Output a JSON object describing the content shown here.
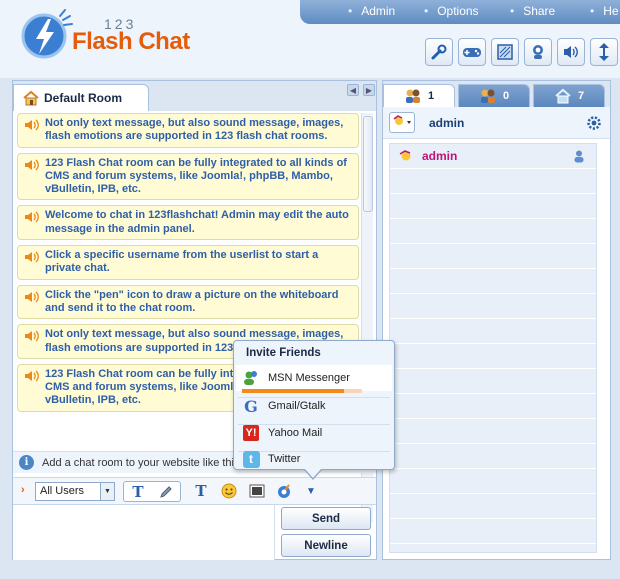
{
  "app": {
    "logo_number": "123",
    "logo_name": "Flash Chat"
  },
  "topnav": {
    "items": [
      "Admin",
      "Options",
      "Share",
      "He"
    ]
  },
  "toolbar_icons": [
    "wrench-icon",
    "gamepad-icon",
    "window-icon",
    "avatar-icon",
    "speaker-icon",
    "resize-icon"
  ],
  "room": {
    "tab_label": "Default Room"
  },
  "messages": [
    "Not only text message, but also sound message, images, flash emotions are supported in 123 flash chat rooms.",
    "123 Flash Chat room can be fully integrated to all kinds of CMS and forum systems, like Joomla!, phpBB, Mambo, vBulletin, IPB, etc.",
    "Welcome to chat in 123flashchat! Admin may edit the auto message in the admin panel.",
    "Click a specific username from the userlist to start a private chat.",
    "Click the \"pen\" icon to draw a picture on the whiteboard and send it to the chat room.",
    "Not only text message, but also sound message, images, flash emotions are supported in 123 flash chat rooms.",
    "123 Flash Chat room can be fully integrated to all kinds of CMS and forum systems, like Joomla!, phpBB, Mambo, vBulletin, IPB, etc."
  ],
  "notice": {
    "text": "Add a chat room to your website like this"
  },
  "input": {
    "recipient": "All Users",
    "send_label": "Send",
    "newline_label": "Newline"
  },
  "user_tabs": [
    {
      "count": "1",
      "icon": "users-icon"
    },
    {
      "count": "0",
      "icon": "users-icon"
    },
    {
      "count": "7",
      "icon": "house-icon"
    }
  ],
  "me": {
    "name": "admin"
  },
  "users": [
    {
      "name": "admin"
    }
  ],
  "invite": {
    "title": "Invite Friends",
    "items": [
      "MSN Messenger",
      "Gmail/Gtalk",
      "Yahoo Mail",
      "Twitter"
    ],
    "msn_progress": 0.85
  },
  "colors": {
    "accent": "#e35d0c",
    "message_text": "#2f5fa8",
    "username": "#c1127a",
    "nav": "#6d96c8"
  }
}
